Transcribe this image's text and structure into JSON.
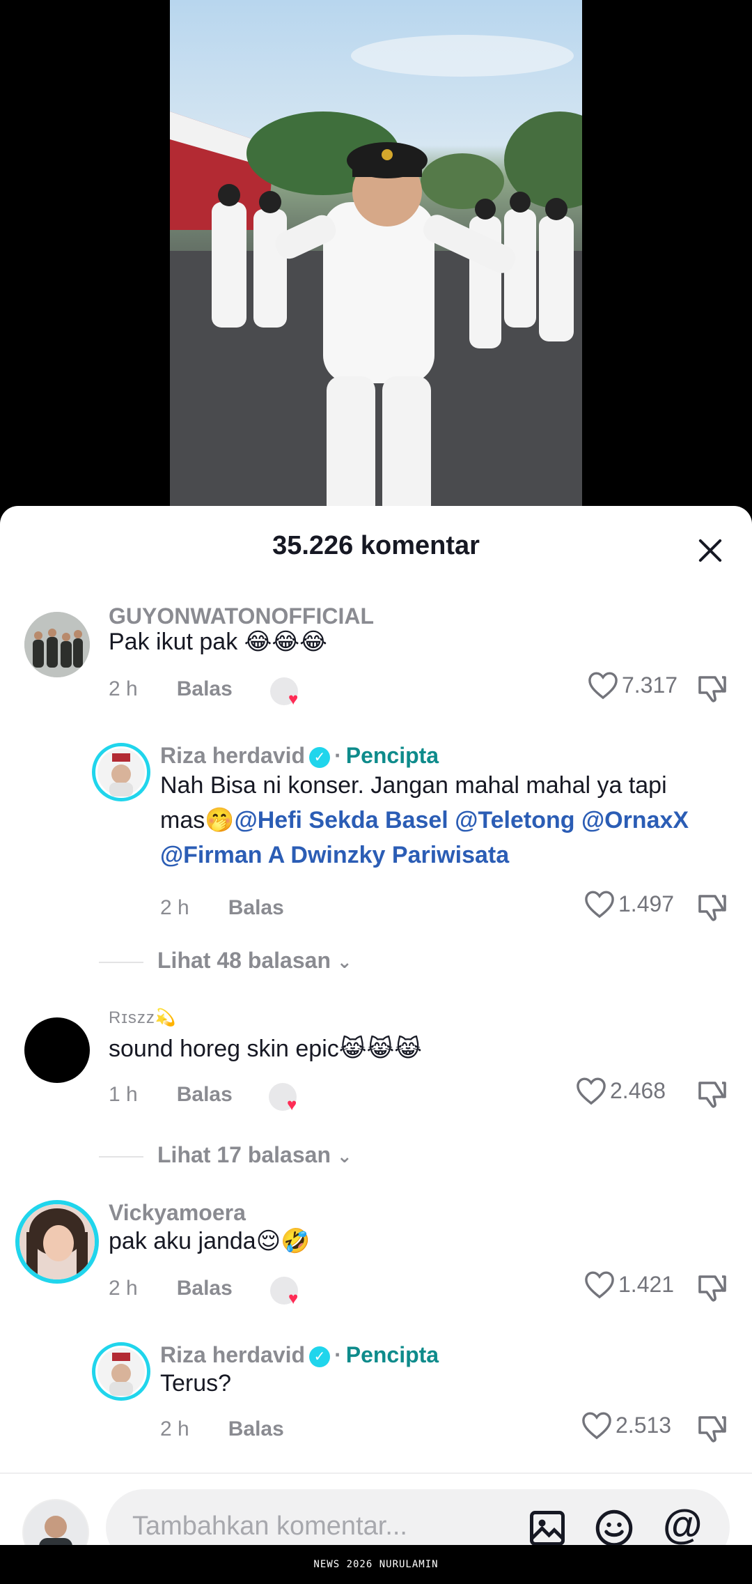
{
  "sheet": {
    "title": "35.226 komentar"
  },
  "comments": [
    {
      "username": "GUYONWATONOFFICIAL",
      "text": "Pak ikut pak 😂😂😂",
      "time": "2 h",
      "reply_label": "Balas",
      "likes": "7.317"
    },
    {
      "username": "Riza herdavid",
      "creator_label": "Pencipta",
      "text_plain": "Nah Bisa ni konser. Jangan mahal mahal ya tapi mas🤭",
      "mentions": [
        "@Hefi Sekda Basel",
        "@Teletong",
        "@OrnaxX",
        "@Firman A Dwinzky Pariwisata"
      ],
      "time": "2 h",
      "reply_label": "Balas",
      "likes": "1.497"
    },
    {
      "username": "Rɪszz💫",
      "text": "sound horeg skin epic😹😹😹",
      "time": "1 h",
      "reply_label": "Balas",
      "likes": "2.468"
    },
    {
      "username": "Vickyamoera",
      "text": "pak aku janda😌🤣",
      "time": "2 h",
      "reply_label": "Balas",
      "likes": "1.421"
    },
    {
      "username": "Riza herdavid",
      "creator_label": "Pencipta",
      "text": "Terus?",
      "time": "2 h",
      "reply_label": "Balas",
      "likes": "2.513"
    }
  ],
  "view_replies": [
    {
      "label": "Lihat 48 balasan"
    },
    {
      "label": "Lihat 17 balasan"
    }
  ],
  "input": {
    "placeholder": "Tambahkan komentar..."
  },
  "footer": {
    "watermark": "NEWS 2026 NURULAMIN"
  },
  "colors": {
    "accent_like": "#fe2c55",
    "creator": "#0e8b8b",
    "mention": "#2b5db5",
    "verified": "#20d5ec"
  },
  "icons": [
    "close-icon",
    "heart-icon",
    "dislike-icon",
    "verified-icon",
    "image-icon",
    "emoji-icon",
    "mention-icon",
    "chevron-down-icon"
  ]
}
